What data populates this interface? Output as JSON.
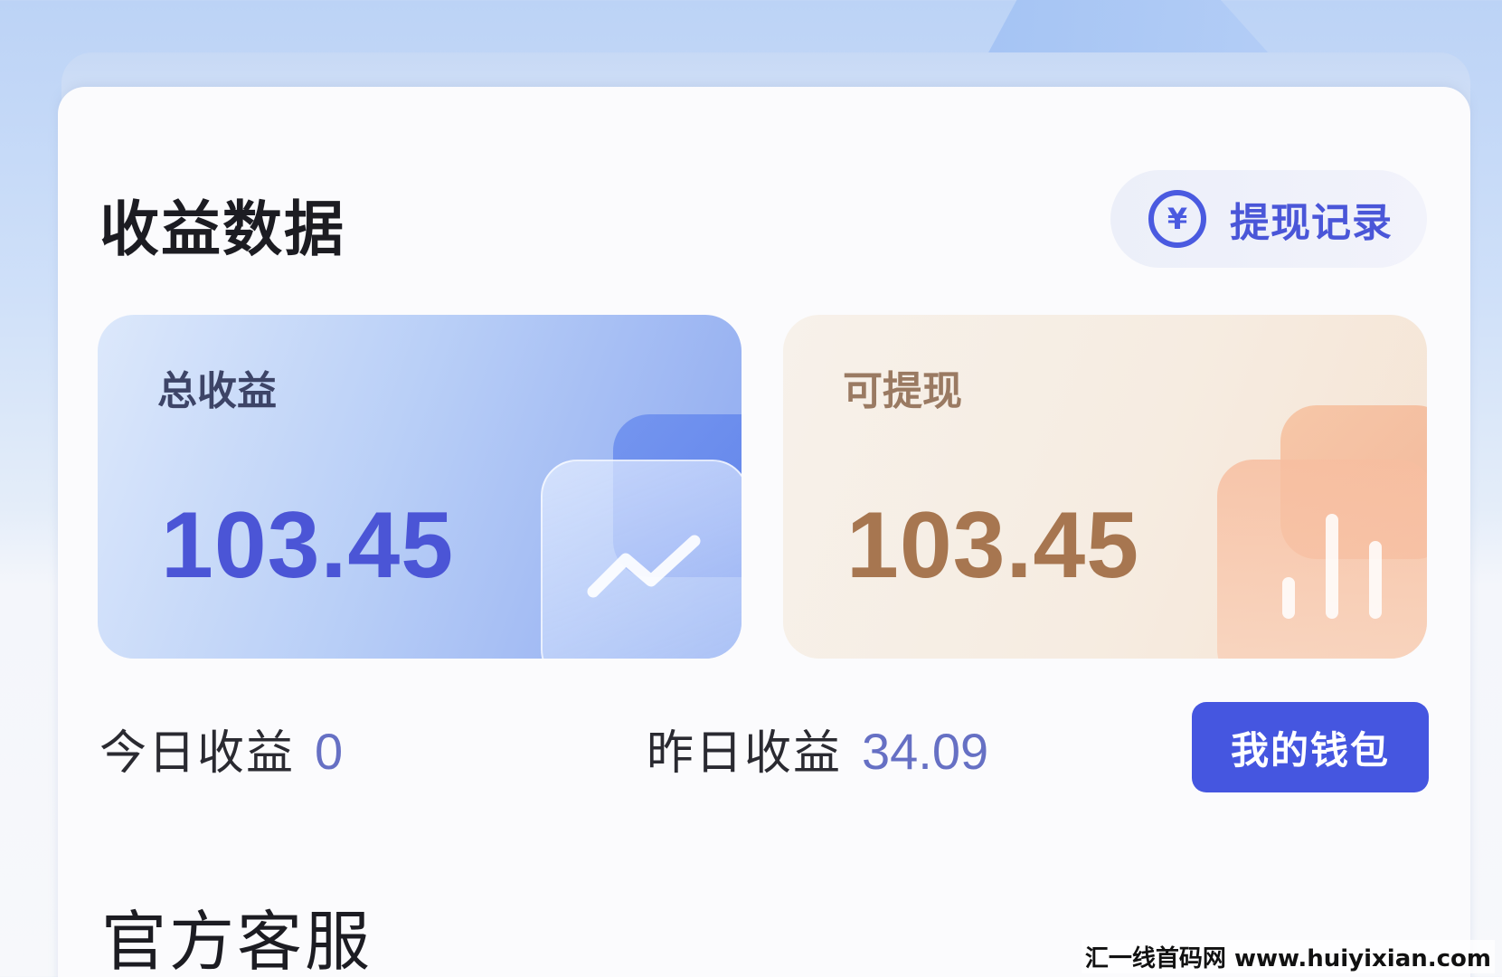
{
  "earnings": {
    "title": "收益数据",
    "withdraw_record_label": "提现记录",
    "yuan_symbol": "¥",
    "total": {
      "label": "总收益",
      "value": "103.45"
    },
    "withdrawable": {
      "label": "可提现",
      "value": "103.45"
    },
    "today": {
      "label": "今日收益",
      "value": "0"
    },
    "yesterday": {
      "label": "昨日收益",
      "value": "34.09"
    },
    "wallet_label": "我的钱包"
  },
  "support": {
    "title": "官方客服"
  },
  "watermark": "汇一线首码网  www.huiyixian.com",
  "colors": {
    "accent": "#4556e0",
    "total_value": "#4b55d6",
    "withdrawable_value": "#a77650"
  },
  "icons": {
    "withdraw_record": "yuan-coin-icon",
    "total_card": "trend-line-icon",
    "withdrawable_card": "bar-chart-icon"
  }
}
